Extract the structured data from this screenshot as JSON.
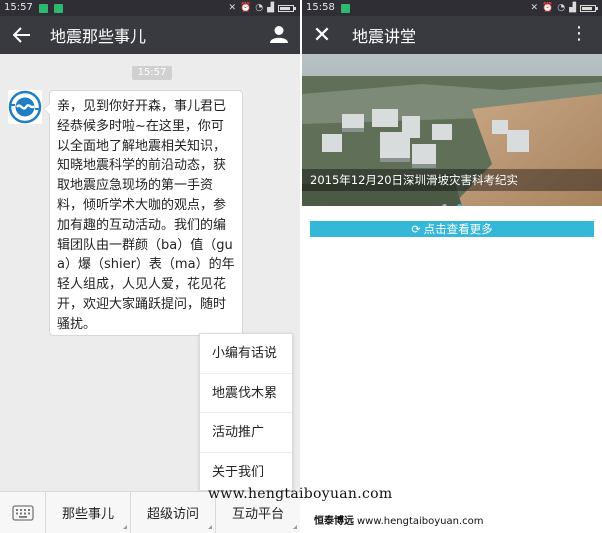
{
  "colors": {
    "statusbar": "#2e2e34",
    "appbar": "#393a3f",
    "chat_bg": "#ececec",
    "accent": "#35b7d8",
    "notif_green": "#2fb86f"
  },
  "left": {
    "status": {
      "time": "15:57",
      "battery_level": 0.85
    },
    "header": {
      "title": "地震那些事儿",
      "back_icon": "arrow-left-icon",
      "profile_icon": "person-icon"
    },
    "chat": {
      "timestamp": "15:57",
      "message": "亲，见到你好开森，事儿君已经恭候多时啦~在这里，你可以全面地了解地震相关知识，知晓地震科学的前沿动态，获取地震应急现场的第一手资料，倾听学术大咖的观点，参加有趣的互动活动。我们的编辑团队由一群颜（ba）值（gua）爆（shier）表（ma）的年轻人组成，人见人爱，花见花开，欢迎大家踊跃提问，随时骚扰。"
    },
    "popup_menu": {
      "items": [
        {
          "label": "小编有话说"
        },
        {
          "label": "地震伐木累"
        },
        {
          "label": "活动推广"
        },
        {
          "label": "关于我们"
        }
      ]
    },
    "bottom_menu": {
      "keyboard_icon": "keyboard-icon",
      "tabs": [
        {
          "label": "那些事儿"
        },
        {
          "label": "超级访问"
        },
        {
          "label": "互动平台"
        }
      ]
    },
    "watermark": "www.hengtaiboyuan.com"
  },
  "right": {
    "status": {
      "time": "15:58",
      "battery_level": 0.85
    },
    "header": {
      "title": "地震讲堂",
      "close_icon": "close-icon",
      "more_icon": "more-vertical-icon"
    },
    "banner": {
      "caption": "2015年12月20日深圳滑坡灾害科考纪实",
      "slide_count": 2,
      "active_slide": 1
    },
    "more_button": {
      "label": "点击查看更多",
      "icon": "refresh-icon"
    },
    "watermark": {
      "brand": "恒泰博远",
      "url": "www.hengtaiboyuan.com"
    }
  }
}
